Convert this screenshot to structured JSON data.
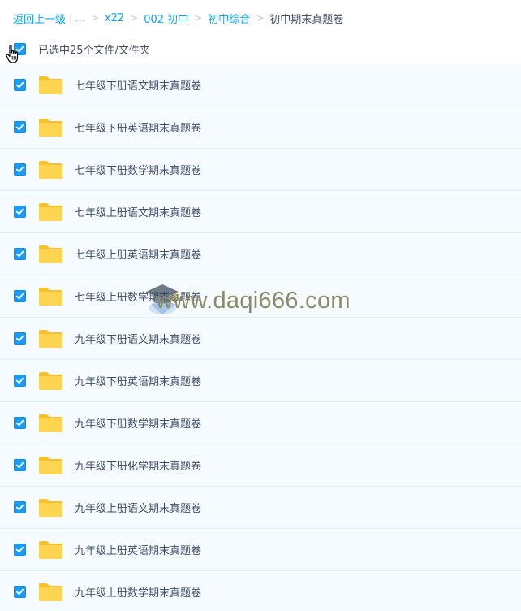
{
  "breadcrumb": {
    "back": "返回上一级",
    "ellipsis": "...",
    "levels": [
      "x22",
      "002 初中",
      "初中综合"
    ],
    "current": "初中期末真题卷"
  },
  "selection": {
    "text": "已选中25个文件/文件夹",
    "checked": true
  },
  "files": [
    {
      "name": "七年级下册语文期末真题卷",
      "checked": true
    },
    {
      "name": "七年级下册英语期末真题卷",
      "checked": true
    },
    {
      "name": "七年级下册数学期末真题卷",
      "checked": true
    },
    {
      "name": "七年级上册语文期末真题卷",
      "checked": true
    },
    {
      "name": "七年级上册英语期末真题卷",
      "checked": true
    },
    {
      "name": "七年级上册数学期末真题卷",
      "checked": true
    },
    {
      "name": "九年级下册语文期末真题卷",
      "checked": true
    },
    {
      "name": "九年级下册英语期末真题卷",
      "checked": true
    },
    {
      "name": "九年级下册数学期末真题卷",
      "checked": true
    },
    {
      "name": "九年级下册化学期末真题卷",
      "checked": true
    },
    {
      "name": "九年级上册语文期末真题卷",
      "checked": true
    },
    {
      "name": "九年级上册英语期末真题卷",
      "checked": true
    },
    {
      "name": "九年级上册数学期末真题卷",
      "checked": true
    }
  ],
  "watermark": {
    "text": "www.daqi666.com"
  },
  "colors": {
    "accent": "#06a7ff",
    "checkbox": "#1a9df7",
    "folder": "#ffd24a",
    "row_background": "#f5fbff",
    "text": "#424e67"
  },
  "icons": {
    "checkbox": "checkmark-icon",
    "folder": "folder-icon",
    "cursor": "hand-pointer-icon",
    "watermark_logo": "graduation-cap-icon"
  }
}
